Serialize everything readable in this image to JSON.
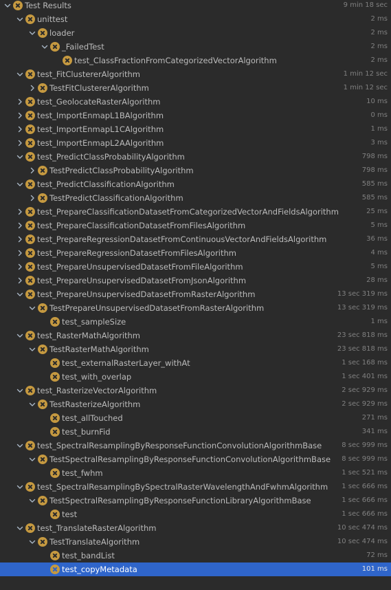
{
  "panel": {
    "title": "Test Results",
    "rows": [
      {
        "label": "Test Results",
        "time": "9 min 18 sec",
        "depth": 0,
        "expanded": true
      },
      {
        "label": "unittest",
        "time": "2 ms",
        "depth": 1,
        "expanded": true
      },
      {
        "label": "loader",
        "time": "2 ms",
        "depth": 2,
        "expanded": true
      },
      {
        "label": "_FailedTest",
        "time": "2 ms",
        "depth": 3,
        "expanded": true
      },
      {
        "label": "test_ClassFractionFromCategorizedVectorAlgorithm",
        "time": "2 ms",
        "depth": 4,
        "expanded": null
      },
      {
        "label": "test_FitClustererAlgorithm",
        "time": "1 min 12 sec",
        "depth": 1,
        "expanded": true
      },
      {
        "label": "TestFitClustererAlgorithm",
        "time": "1 min 12 sec",
        "depth": 2,
        "expanded": false
      },
      {
        "label": "test_GeolocateRasterAlgorithm",
        "time": "10 ms",
        "depth": 1,
        "expanded": false
      },
      {
        "label": "test_ImportEnmapL1BAlgorithm",
        "time": "0 ms",
        "depth": 1,
        "expanded": false
      },
      {
        "label": "test_ImportEnmapL1CAlgorithm",
        "time": "1 ms",
        "depth": 1,
        "expanded": false
      },
      {
        "label": "test_ImportEnmapL2AAlgorithm",
        "time": "3 ms",
        "depth": 1,
        "expanded": false
      },
      {
        "label": "test_PredictClassProbabilityAlgorithm",
        "time": "798 ms",
        "depth": 1,
        "expanded": true
      },
      {
        "label": "TestPredictClassProbabilityAlgorithm",
        "time": "798 ms",
        "depth": 2,
        "expanded": false
      },
      {
        "label": "test_PredictClassificationAlgorithm",
        "time": "585 ms",
        "depth": 1,
        "expanded": true
      },
      {
        "label": "TestPredictClassificationAlgorithm",
        "time": "585 ms",
        "depth": 2,
        "expanded": false
      },
      {
        "label": "test_PrepareClassificationDatasetFromCategorizedVectorAndFieldsAlgorithm",
        "time": "25 ms",
        "depth": 1,
        "expanded": false
      },
      {
        "label": "test_PrepareClassificationDatasetFromFilesAlgorithm",
        "time": "5 ms",
        "depth": 1,
        "expanded": false
      },
      {
        "label": "test_PrepareRegressionDatasetFromContinuousVectorAndFieldsAlgorithm",
        "time": "36 ms",
        "depth": 1,
        "expanded": false
      },
      {
        "label": "test_PrepareRegressionDatasetFromFilesAlgorithm",
        "time": "4 ms",
        "depth": 1,
        "expanded": false
      },
      {
        "label": "test_PrepareUnsupervisedDatasetFromFileAlgorithm",
        "time": "5 ms",
        "depth": 1,
        "expanded": false
      },
      {
        "label": "test_PrepareUnsupervisedDatasetFromJsonAlgorithm",
        "time": "28 ms",
        "depth": 1,
        "expanded": false
      },
      {
        "label": "test_PrepareUnsupervisedDatasetFromRasterAlgorithm",
        "time": "13 sec 319 ms",
        "depth": 1,
        "expanded": true
      },
      {
        "label": "TestPrepareUnsupervisedDatasetFromRasterAlgorithm",
        "time": "13 sec 319 ms",
        "depth": 2,
        "expanded": true
      },
      {
        "label": "test_sampleSize",
        "time": "1 ms",
        "depth": 3,
        "expanded": null
      },
      {
        "label": "test_RasterMathAlgorithm",
        "time": "23 sec 818 ms",
        "depth": 1,
        "expanded": true
      },
      {
        "label": "TestRasterMathAlgorithm",
        "time": "23 sec 818 ms",
        "depth": 2,
        "expanded": true
      },
      {
        "label": "test_externalRasterLayer_withAt",
        "time": "1 sec 168 ms",
        "depth": 3,
        "expanded": null
      },
      {
        "label": "test_with_overlap",
        "time": "1 sec 401 ms",
        "depth": 3,
        "expanded": null
      },
      {
        "label": "test_RasterizeVectorAlgorithm",
        "time": "2 sec 929 ms",
        "depth": 1,
        "expanded": true
      },
      {
        "label": "TestRasterizeAlgorithm",
        "time": "2 sec 929 ms",
        "depth": 2,
        "expanded": true
      },
      {
        "label": "test_allTouched",
        "time": "271 ms",
        "depth": 3,
        "expanded": null
      },
      {
        "label": "test_burnFid",
        "time": "341 ms",
        "depth": 3,
        "expanded": null
      },
      {
        "label": "test_SpectralResamplingByResponseFunctionConvolutionAlgorithmBase",
        "time": "8 sec 999 ms",
        "depth": 1,
        "expanded": true
      },
      {
        "label": "TestSpectralResamplingByResponseFunctionConvolutionAlgorithmBase",
        "time": "8 sec 999 ms",
        "depth": 2,
        "expanded": true
      },
      {
        "label": "test_fwhm",
        "time": "1 sec 521 ms",
        "depth": 3,
        "expanded": null
      },
      {
        "label": "test_SpectralResamplingBySpectralRasterWavelengthAndFwhmAlgorithm",
        "time": "1 sec 666 ms",
        "depth": 1,
        "expanded": true
      },
      {
        "label": "TestSpectralResamplingByResponseFunctionLibraryAlgorithmBase",
        "time": "1 sec 666 ms",
        "depth": 2,
        "expanded": true
      },
      {
        "label": "test",
        "time": "1 sec 666 ms",
        "depth": 3,
        "expanded": null
      },
      {
        "label": "test_TranslateRasterAlgorithm",
        "time": "10 sec 474 ms",
        "depth": 1,
        "expanded": true
      },
      {
        "label": "TestTranslateAlgorithm",
        "time": "10 sec 474 ms",
        "depth": 2,
        "expanded": true
      },
      {
        "label": "test_bandList",
        "time": "72 ms",
        "depth": 3,
        "expanded": null
      },
      {
        "label": "test_copyMetadata",
        "time": "101 ms",
        "depth": 3,
        "expanded": null,
        "selected": true
      }
    ]
  },
  "icons": {
    "status": "test-error-icon",
    "expanded": "chevron-down-icon",
    "collapsed": "chevron-right-icon"
  },
  "colors": {
    "background": "#2b2b2b",
    "status_icon": "#c59940",
    "selection": "#2f65ca",
    "text": "#bbbbbb",
    "time_text": "#808080"
  }
}
